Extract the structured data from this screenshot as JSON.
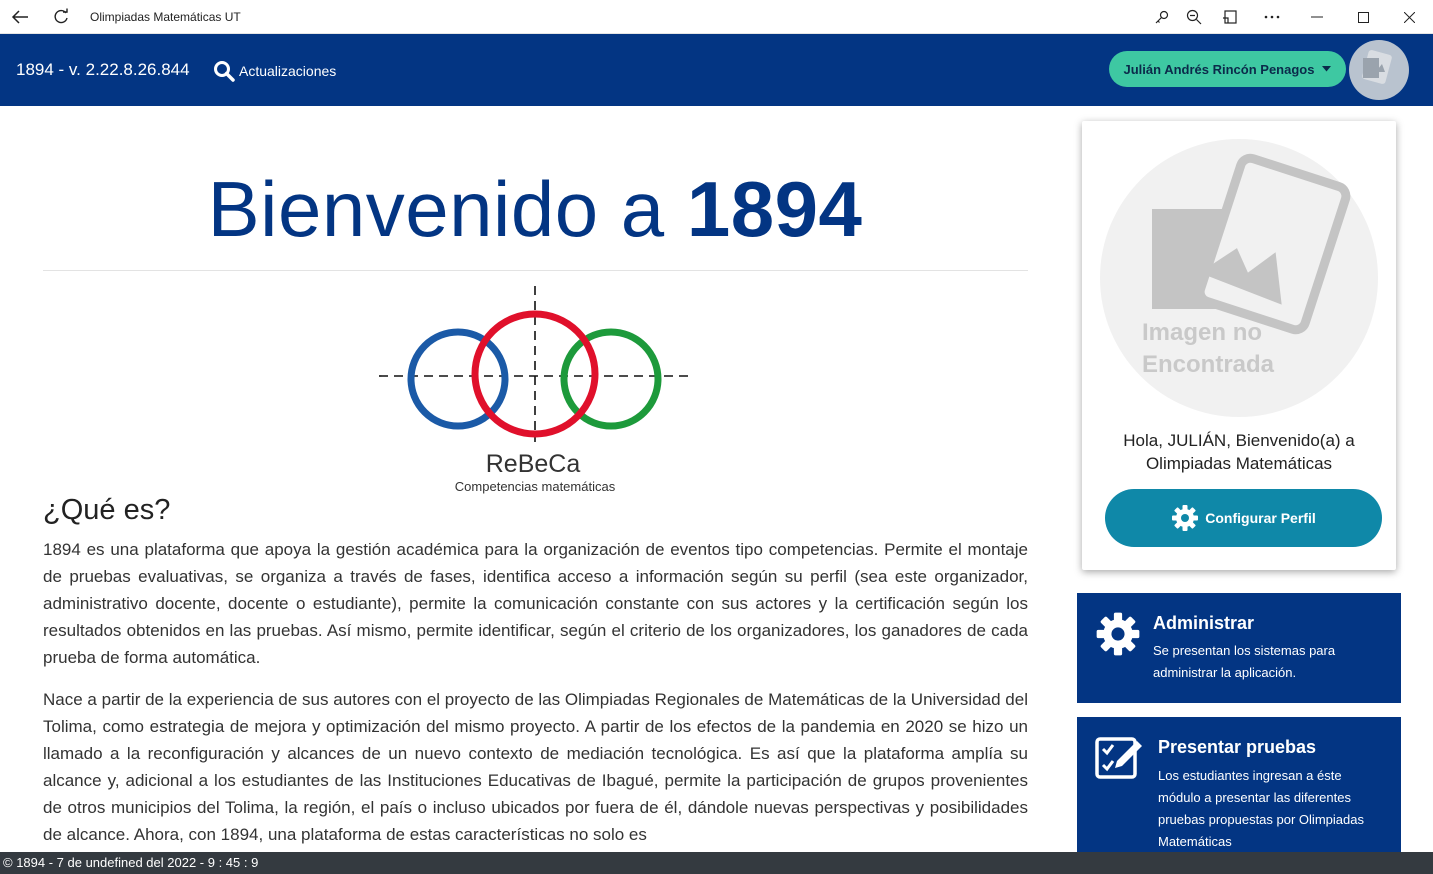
{
  "window": {
    "title": "Olimpiadas Matemáticas UT",
    "controls": [
      "back-icon",
      "refresh-icon",
      "key-icon",
      "zoom-icon",
      "cast-icon",
      "more-icon",
      "minimize-icon",
      "maximize-icon",
      "close-icon"
    ]
  },
  "header": {
    "version": "1894 - v. 2.22.8.26.844",
    "updates_label": "Actualizaciones",
    "user_name": "Julián Andrés Rincón Penagos",
    "avatar_text": "Imagen no Encontrada"
  },
  "main": {
    "welcome_prefix": "Bienvenido a",
    "welcome_brand": "1894",
    "logo_name": "ReBeCa",
    "logo_subtitle": "Competencias matemáticas",
    "section_title": "¿Qué es?",
    "paragraph1": "1894 es una plataforma que apoya la gestión académica para la organización de eventos tipo competencias. Permite el montaje de pruebas evaluativas, se organiza a través de fases, identifica acceso a información según su perfil (sea este organizador, administrativo docente, docente o estudiante), permite la comunicación constante con sus actores y la certificación según los resultados obtenidos en las pruebas. Así mismo, permite identificar, según el criterio de los organizadores, los ganadores de cada prueba de forma automática.",
    "paragraph2": "Nace a partir de la experiencia de sus autores con el proyecto de las Olimpiadas Regionales de Matemáticas de la Universidad del Tolima, como estrategia de mejora y optimización del mismo proyecto. A partir de los efectos de la pandemia en 2020 se hizo un llamado a la reconfiguración y alcances de un nuevo contexto de mediación tecnológica. Es así que la plataforma amplía su alcance y, adicional a los estudiantes de las Instituciones Educativas de Ibagué, permite la participación de grupos provenientes de otros municipios del Tolima, la región, el país o incluso ubicados por fuera de él, dándole nuevas perspectivas y posibilidades de alcance. Ahora, con 1894, una plataforma de estas características no solo es"
  },
  "profile": {
    "no_image_text": "Imagen no Encontrada",
    "greeting": "Hola, JULIÁN, Bienvenido(a) a Olimpiadas Matemáticas",
    "config_button": "Configurar Perfil"
  },
  "tiles": {
    "admin": {
      "title": "Administrar",
      "description": "Se presentan los sistemas para administrar la aplicación."
    },
    "tests": {
      "title": "Presentar pruebas",
      "description": "Los estudiantes ingresan a éste módulo a presentar las diferentes pruebas propuestas por Olimpiadas Matemáticas"
    }
  },
  "status": {
    "text": "© 1894 - 7 de undefined del 2022 - 9 : 45 : 9"
  },
  "colors": {
    "primary": "#033583",
    "user_button": "#3ec8a2",
    "config_button": "#0f88a8",
    "status_bar": "#343a40"
  }
}
